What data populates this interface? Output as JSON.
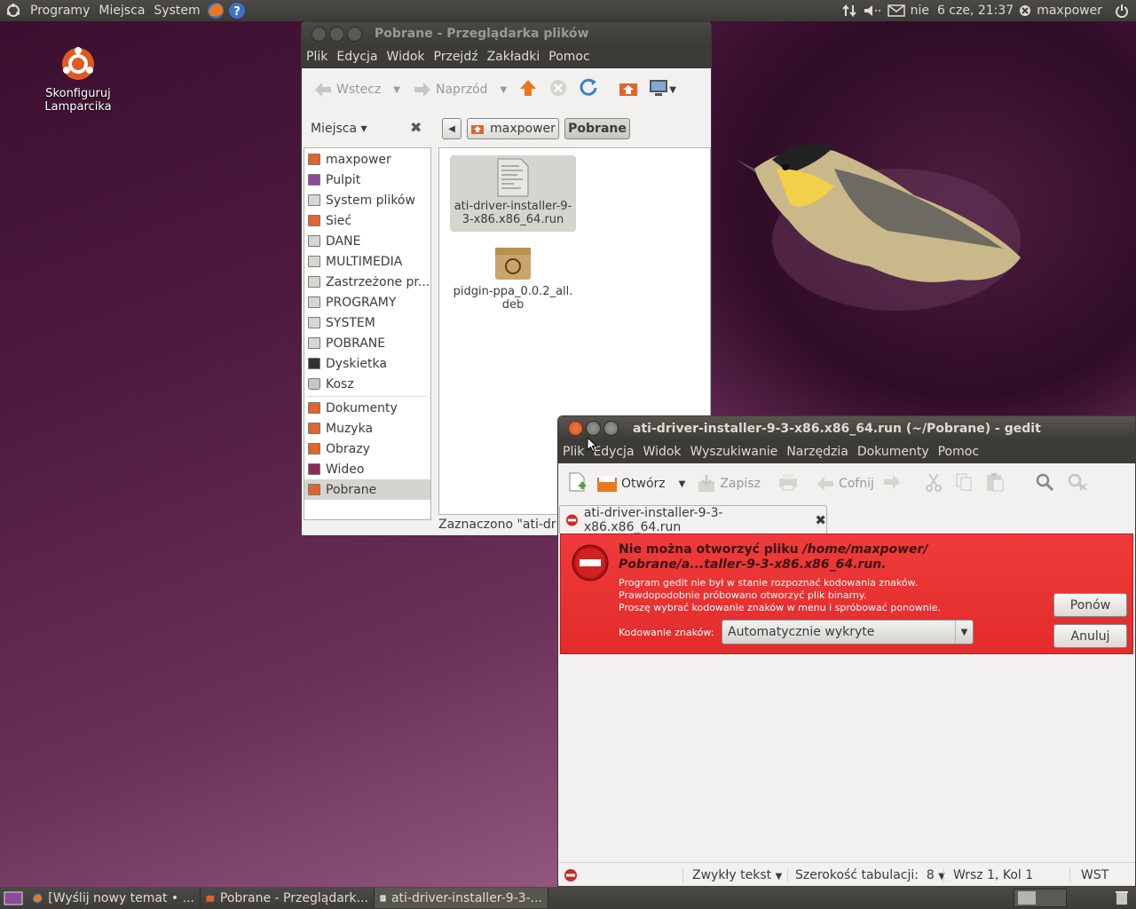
{
  "top_panel": {
    "menus": [
      "Programy",
      "Miejsca",
      "System"
    ],
    "clock": "nie  6 cze, 21:37",
    "user": "maxpower"
  },
  "desktop_icon": {
    "line1": "Skonfiguruj",
    "line2": "Lamparcika"
  },
  "nautilus": {
    "title": "Pobrane - Przeglądarka plików",
    "menus": [
      "Plik",
      "Edycja",
      "Widok",
      "Przejdź",
      "Zakładki",
      "Pomoc"
    ],
    "back": "Wstecz",
    "forward": "Naprzód",
    "places_label": "Miejsca",
    "path": [
      "maxpower",
      "Pobrane"
    ],
    "sidebar": [
      "maxpower",
      "Pulpit",
      "System plików",
      "Sieć",
      "DANE",
      "MULTIMEDIA",
      "Zastrzeżone pr...",
      "PROGRAMY",
      "SYSTEM",
      "POBRANE",
      "Dyskietka",
      "Kosz"
    ],
    "sidebar2": [
      "Dokumenty",
      "Muzyka",
      "Obrazy",
      "Wideo",
      "Pobrane"
    ],
    "files": [
      {
        "line1": "ati-driver-installer-9-",
        "line2": "3-x86.x86_64.run"
      },
      {
        "line1": "pidgin-ppa_0.0.2_all.",
        "line2": "deb"
      }
    ],
    "status": "Zaznaczono \"ati-driv"
  },
  "gedit": {
    "title": "ati-driver-installer-9-3-x86.x86_64.run (~/Pobrane) - gedit",
    "menus": [
      "Plik",
      "Edycja",
      "Widok",
      "Wyszukiwanie",
      "Narzędzia",
      "Dokumenty",
      "Pomoc"
    ],
    "toolbar": {
      "open": "Otwórz",
      "save": "Zapisz",
      "undo": "Cofnij"
    },
    "tab": "ati-driver-installer-9-3-x86.x86_64.run",
    "error": {
      "title_a": "Nie można otworzyć pliku ",
      "title_b": "/home/maxpower/",
      "title_c": "Pobrane/a...taller-9-3-x86.x86_64.run.",
      "line1": "Program gedit nie był w stanie rozpoznać kodowania znaków.",
      "line2": "Prawdopodobnie próbowano otworzyć plik binarny.",
      "line3": "Proszę wybrać kodowanie znaków w menu i spróbować ponownie.",
      "encoding_label": "Kodowanie znaków:",
      "encoding_value": "Automatycznie wykryte",
      "retry": "Ponów",
      "cancel": "Anuluj"
    },
    "statusbar": {
      "mode": "Zwykły tekst",
      "tab_width": "Szerokość tabulacji:  8",
      "position": "Wrsz 1, Kol 1",
      "insert": "WST"
    }
  },
  "taskbar": [
    "[Wyślij nowy temat • ...",
    "Pobrane - Przeglądark...",
    "ati-driver-installer-9-3-..."
  ]
}
